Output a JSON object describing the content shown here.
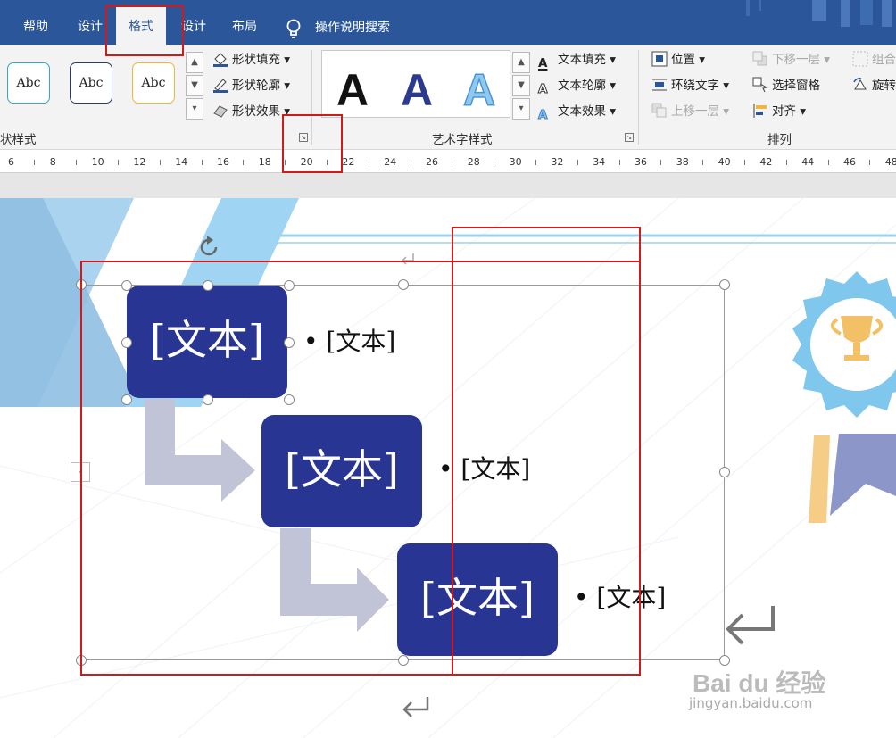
{
  "tabs": {
    "help": "帮助",
    "design1": "设计",
    "format": "格式",
    "design2": "设计",
    "layout": "布局",
    "search": "操作说明搜索"
  },
  "ribbon": {
    "shape_styles": {
      "abc1": "Abc",
      "abc2": "Abc",
      "abc3": "Abc",
      "fill": "形状填充",
      "outline": "形状轮廓",
      "effects": "形状效果",
      "group_label": "状样式"
    },
    "wordart": {
      "letter": "A",
      "text_fill": "文本填充",
      "text_outline": "文本轮廓",
      "text_effects": "文本效果",
      "group_label": "艺术字样式"
    },
    "arrange": {
      "position": "位置",
      "wrap_text": "环绕文字",
      "bring_forward": "上移一层",
      "send_backward": "下移一层",
      "selection_pane": "选择窗格",
      "align": "对齐",
      "group": "组合",
      "rotate": "旋转",
      "group_label": "排列"
    }
  },
  "ruler": [
    "6",
    "8",
    "10",
    "12",
    "14",
    "16",
    "18",
    "20",
    "22",
    "24",
    "26",
    "28",
    "30",
    "32",
    "34",
    "36",
    "38",
    "40",
    "42",
    "44",
    "46",
    "48"
  ],
  "smartart": {
    "box1": "[文本]",
    "box2": "[文本]",
    "box3": "[文本]",
    "bullet1": "[文本]",
    "bullet2": "[文本]",
    "bullet3": "[文本]"
  },
  "watermark": {
    "logo": "Bai du 经验",
    "url": "jingyan.baidu.com"
  },
  "colors": {
    "tab_bar": "#2b579a",
    "ribbon_bg": "#f3f3f3",
    "smart_box": "#283593",
    "arrow": "#c1c4d6",
    "highlight": "#d01b1b"
  }
}
